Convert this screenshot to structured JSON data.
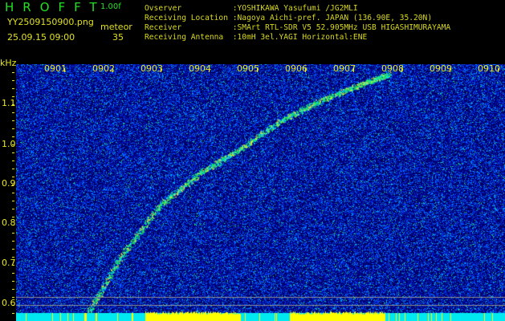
{
  "header": {
    "app_title": "HROFFT",
    "version": "1.00f",
    "filename": "YY2509150900.png",
    "datetime": "25.09.15 09:00",
    "mode_label": "meteor",
    "meteor_count": "35"
  },
  "info": [
    "Ovserver           :YOSHIKAWA Yasufumi /JG2MLI",
    "Receiving Location :Nagoya Aichi-pref. JAPAN (136.90E, 35.20N)",
    "Receiver           :SMArt RTL-SDR V5 52.905MHz USB HIGASHIMURAYAMA",
    "Receiving Antenna  :10mH 3el.YAGI Horizontal:ENE"
  ],
  "axis": {
    "y_unit": "kHz",
    "y_labels": [
      "1.1",
      "1.0",
      "0.9",
      "0.8",
      "0.7",
      "0.6"
    ],
    "time_labels": [
      "0901",
      "0902",
      "0903",
      "0904",
      "0905",
      "0906",
      "0907",
      "0908",
      "0909",
      "0910"
    ]
  },
  "colors": {
    "label": "#e8e820",
    "title": "#22e022",
    "bottom_bar": "#00e8f0",
    "bottom_spikes": "#ffff00"
  }
}
